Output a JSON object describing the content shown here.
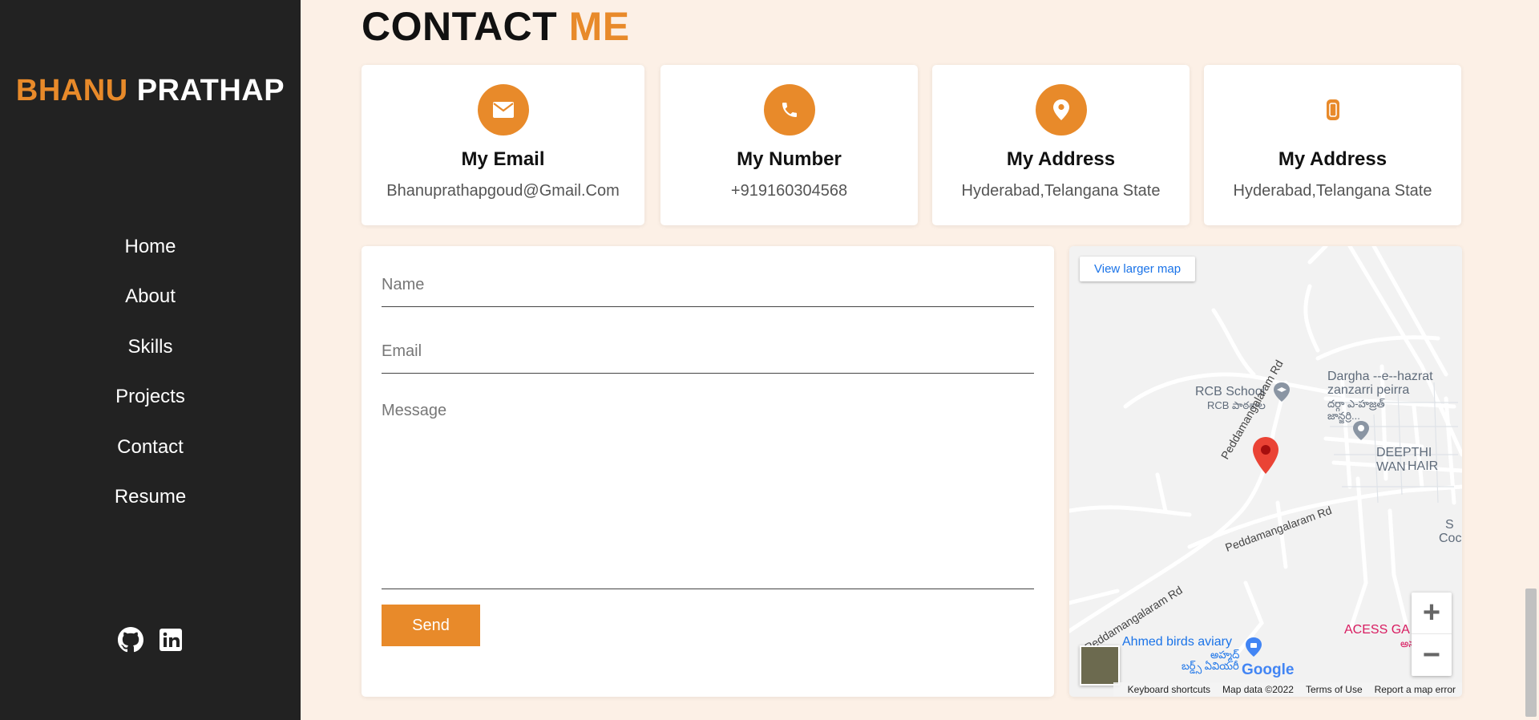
{
  "brand": {
    "first": "BHANU",
    "last": "PRATHAP"
  },
  "nav": [
    "Home",
    "About",
    "Skills",
    "Projects",
    "Contact",
    "Resume"
  ],
  "social": {
    "github_icon": "github-icon",
    "linkedin_icon": "linkedin-icon"
  },
  "section": {
    "title_main": "CONTACT",
    "title_accent": "ME"
  },
  "cards": [
    {
      "icon": "envelope-icon",
      "title": "My Email",
      "value": "Bhanuprathapgoud@Gmail.Com"
    },
    {
      "icon": "phone-icon",
      "title": "My Number",
      "value": "+919160304568"
    },
    {
      "icon": "map-pin-icon",
      "title": "My Address",
      "value": "Hyderabad,Telangana State"
    },
    {
      "icon": "mobile-icon",
      "title": "My Address",
      "value": "Hyderabad,Telangana State"
    }
  ],
  "form": {
    "name_placeholder": "Name",
    "email_placeholder": "Email",
    "message_placeholder": "Message",
    "send_label": "Send"
  },
  "map": {
    "view_larger": "View larger map",
    "labels": {
      "rcb_school": "RCB School",
      "rcb_school_te": "RCB పాఠశాల",
      "dargha_1": "Dargha --e--hazrat",
      "dargha_2": "zanzarri peirra",
      "dargha_3": "దర్గా ఎ-హజ్రత్",
      "dargha_4": "జాన్జర్రి...",
      "deepthi_1": "DEEPTHI WAN",
      "deepthi_2": "HAIR",
      "road_1": "Peddamangalaram Rd",
      "road_2": "Peddamangalaram Rd",
      "road_3": "Peddamangalaram Rd",
      "ahmed": "Ahmed birds aviary",
      "ahmed_te_1": "అహ్మద్",
      "ahmed_te_2": "బర్డ్స్ ఏవియరీ",
      "acess": "ACESS GA",
      "acess_te": "అస్ప",
      "s_coc_1": "S",
      "s_coc_2": "Coc"
    },
    "zoom_in": "+",
    "zoom_out": "−",
    "google": "Google",
    "footer": [
      "Keyboard shortcuts",
      "Map data ©2022",
      "Terms of Use",
      "Report a map error"
    ]
  },
  "colors": {
    "accent": "#e88a2a",
    "sidebar": "#222222",
    "background": "#fcf0e6"
  }
}
